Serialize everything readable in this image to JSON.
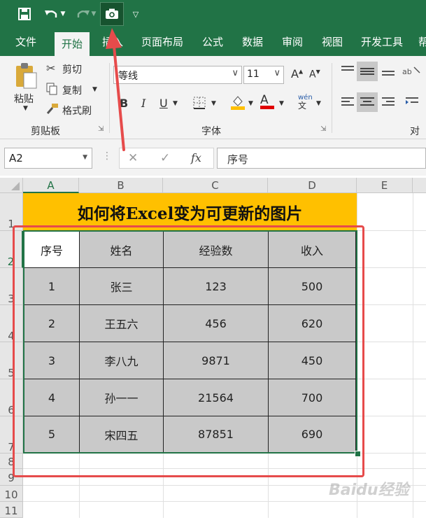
{
  "tabs": [
    "文件",
    "开始",
    "插入",
    "页面布局",
    "公式",
    "数据",
    "审阅",
    "视图",
    "开发工具",
    "帮"
  ],
  "clipboard": {
    "paste": "粘贴",
    "cut": "剪切",
    "copy": "复制",
    "format_painter": "格式刷",
    "group": "剪贴板"
  },
  "font": {
    "name": "等线",
    "size": "11",
    "grow": "A",
    "shrink": "A",
    "bold": "B",
    "italic": "I",
    "underline": "U",
    "fill_letter": "",
    "font_color": "A",
    "phonetic": "wén",
    "group": "字体"
  },
  "alignment": {
    "group": "对齐"
  },
  "formula_bar": {
    "name_box": "A2",
    "cancel": "✕",
    "enter": "✓",
    "fx": "fx",
    "content": "序号"
  },
  "columns": [
    "A",
    "B",
    "C",
    "D",
    "E"
  ],
  "rows": [
    "1",
    "2",
    "3",
    "4",
    "5",
    "6",
    "7",
    "8",
    "9",
    "10",
    "11"
  ],
  "title": "如何将Excel变为可更新的图片",
  "table": {
    "headers": [
      "序号",
      "姓名",
      "经验数",
      "收入"
    ],
    "rows": [
      [
        "1",
        "张三",
        "123",
        "500"
      ],
      [
        "2",
        "王五六",
        "456",
        "620"
      ],
      [
        "3",
        "李八九",
        "9871",
        "450"
      ],
      [
        "4",
        "孙一一",
        "21564",
        "700"
      ],
      [
        "5",
        "宋四五",
        "87851",
        "690"
      ]
    ]
  },
  "watermark": "Baidu经验",
  "colors": {
    "excel_green": "#217346",
    "title_fill": "#ffc000",
    "cell_fill": "#c9c9c9",
    "highlight_red": "#e64b4b"
  }
}
